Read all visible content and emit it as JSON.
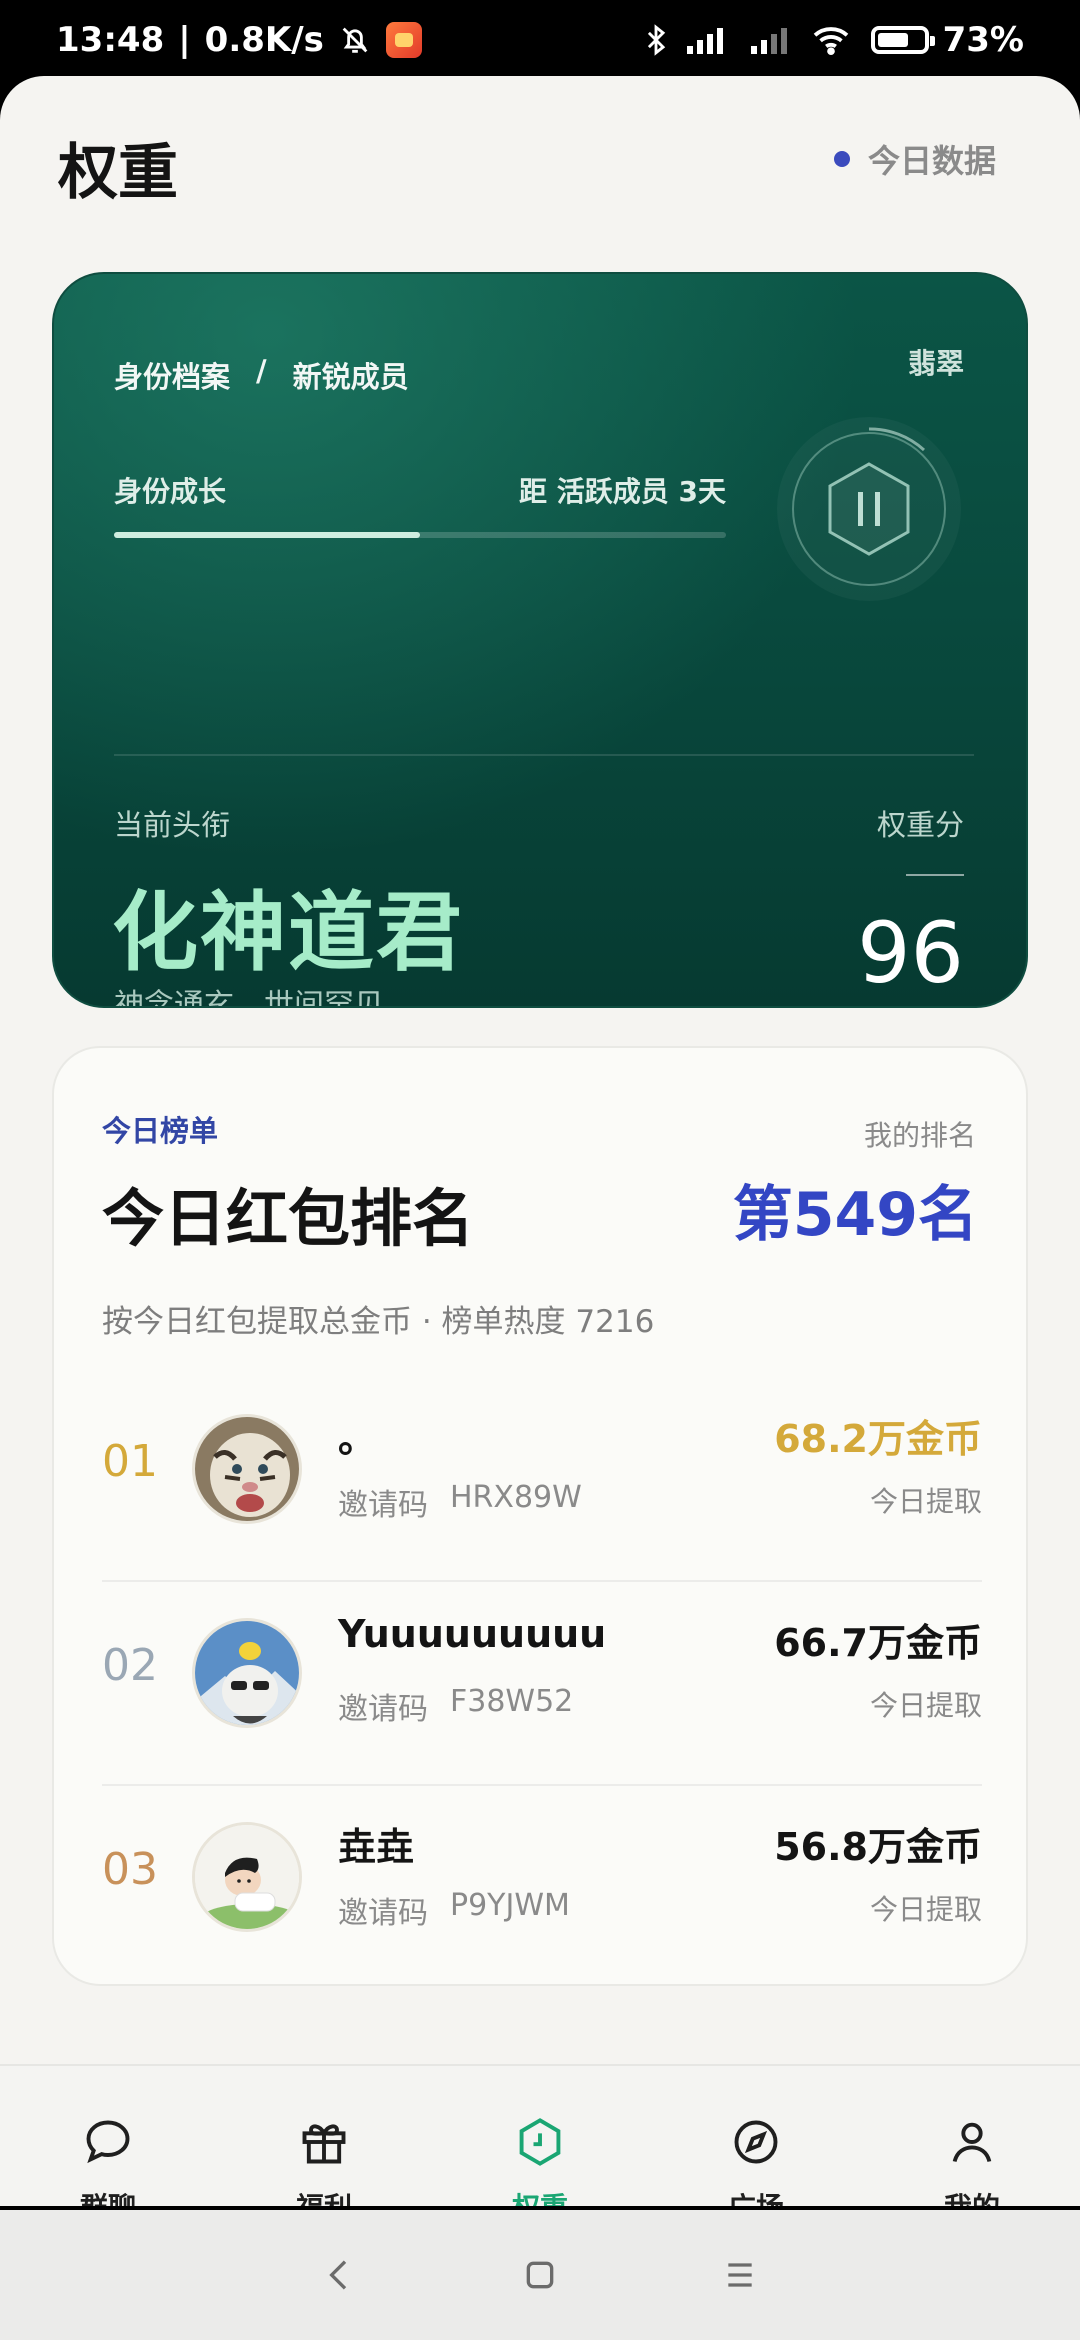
{
  "status_bar": {
    "time": "13:48",
    "net_speed": "0.8K/s",
    "battery": "73%",
    "battery_level": 0.73
  },
  "header": {
    "title": "权重",
    "today_link": "今日数据"
  },
  "identity": {
    "breadcrumb_root": "身份档案",
    "breadcrumb_sep": "/",
    "breadcrumb_current": "新锐成员",
    "tier": "翡翠",
    "growth_label": "身份成长",
    "growth_remaining": "距 活跃成员 3天",
    "growth_progress": 0.5,
    "current_title_label": "当前头衔",
    "current_title": "化神道君",
    "current_title_sub": "神念通玄，世间罕见",
    "score_label": "权重分",
    "score": "96"
  },
  "ranking": {
    "eyebrow": "今日榜单",
    "title": "今日红包排名",
    "my_rank_label": "我的排名",
    "my_rank": "第549名",
    "description": "按今日红包提取总金币 · 榜单热度 7216",
    "entries": [
      {
        "rank": "01",
        "name": "。",
        "code_label": "邀请码",
        "code": "HRX89W",
        "amount": "68.2万金币",
        "note": "今日提取",
        "rank_color": "#d4a93a",
        "amount_color": "#d4a93a",
        "avatar": "tiger-avatar"
      },
      {
        "rank": "02",
        "name": "Yuuuuuuuuu",
        "code_label": "邀请码",
        "code": "F38W52",
        "amount": "66.7万金币",
        "note": "今日提取",
        "rank_color": "#9aa7b4",
        "amount_color": "#141414",
        "avatar": "cat-avatar"
      },
      {
        "rank": "03",
        "name": "垚垚",
        "code_label": "邀请码",
        "code": "P9YJWM",
        "amount": "56.8万金币",
        "note": "今日提取",
        "rank_color": "#c8915a",
        "amount_color": "#141414",
        "avatar": "boy-avatar"
      }
    ]
  },
  "bottom_nav": {
    "items": [
      {
        "label": "群聊",
        "icon": "chat-icon"
      },
      {
        "label": "福利",
        "icon": "gift-icon"
      },
      {
        "label": "权重",
        "icon": "weight-icon",
        "active": true
      },
      {
        "label": "广场",
        "icon": "compass-icon"
      },
      {
        "label": "我的",
        "icon": "profile-icon"
      }
    ]
  },
  "colors": {
    "accent_green": "#1aa673",
    "rank_blue": "#3346c4",
    "card_green": "#094a3e"
  }
}
